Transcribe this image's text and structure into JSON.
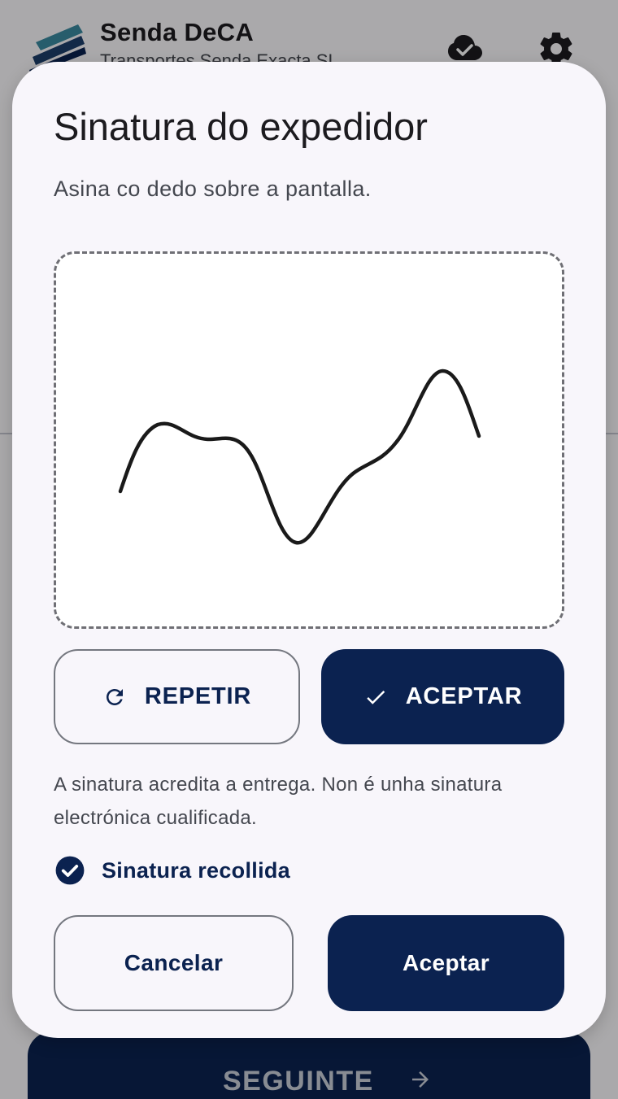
{
  "app": {
    "title": "Senda DeCA",
    "subtitle": "Transportes Senda Exacta SL",
    "next_label": "SEGUINTE"
  },
  "dialog": {
    "title": "Sinatura do expedidor",
    "subtitle": "Asina co dedo sobre a pantalla.",
    "repeat_label": "REPETIR",
    "accept_signature_label": "ACEPTAR",
    "disclaimer": "A sinatura acredita a entrega. Non é unha sinatura electrónica cualificada.",
    "status_text": "Sinatura recollida",
    "cancel_label": "Cancelar",
    "accept_label": "Aceptar"
  },
  "colors": {
    "primary": "#0b2250",
    "surface": "#f8f6fb",
    "outline": "#74777f",
    "scrim": "rgba(0,0,0,0.32)"
  },
  "icons": {
    "logo": "stripes-logo",
    "cloud": "cloud-done-icon",
    "settings": "gear-icon",
    "repeat": "refresh-icon",
    "accept": "check-icon",
    "status": "check-circle-icon",
    "next": "arrow-right-icon"
  }
}
